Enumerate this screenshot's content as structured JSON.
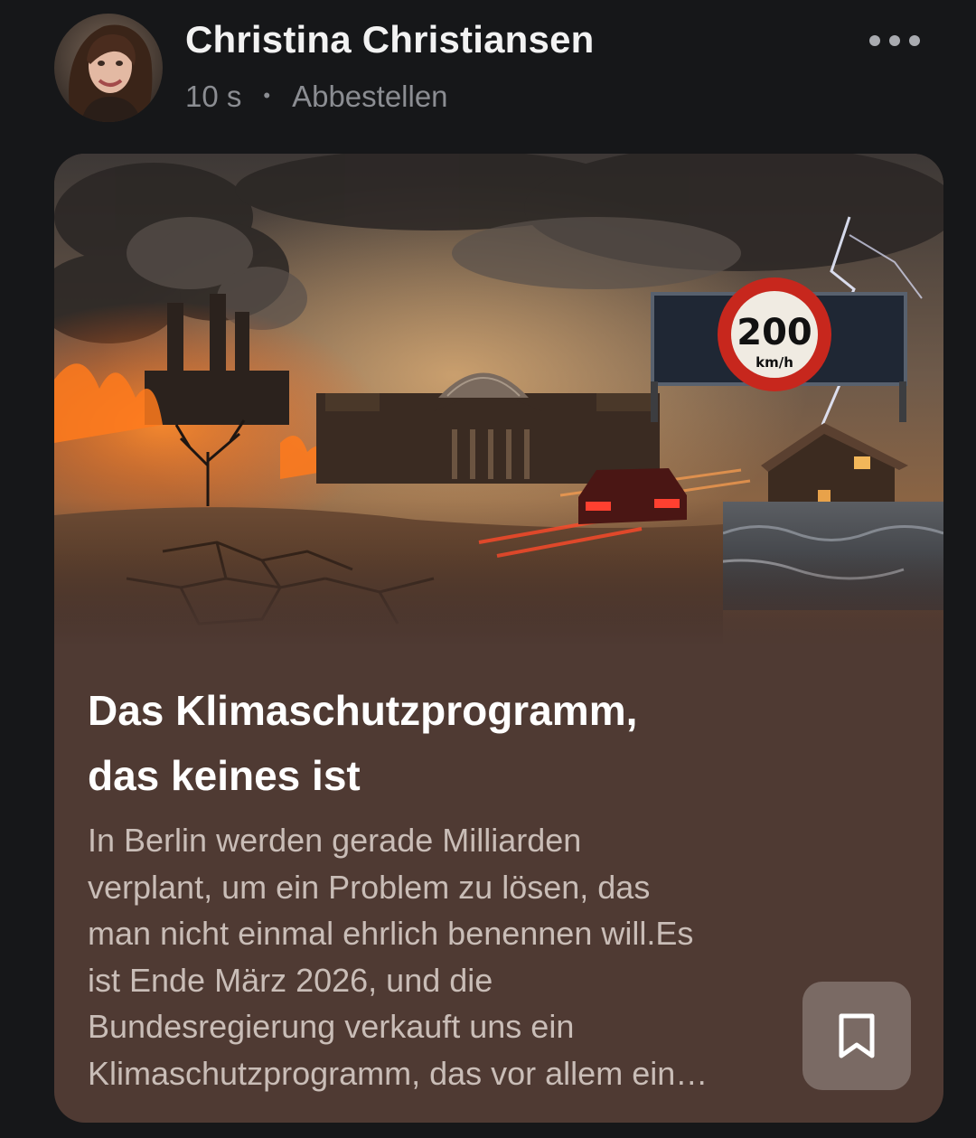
{
  "post": {
    "author_name": "Christina Christiansen",
    "time_ago": "10 s",
    "separator": "•",
    "unsubscribe_label": "Abbestellen"
  },
  "icons": {
    "more": "more-horizontal-icon",
    "bookmark": "bookmark-icon"
  },
  "card": {
    "title_line1": "Das Klimaschutzprogramm,",
    "title_line2": "das keines ist",
    "excerpt_lines": [
      "In Berlin werden gerade Milliarden",
      "verplant, um ein Problem zu lösen, das",
      "man nicht einmal ehrlich benennen will.Es",
      "ist Ende März 2026, und die",
      "Bundesregierung verkauft uns ein",
      "Klimaschutzprogramm, das vor allem ein…"
    ],
    "image": {
      "sign_value": "200",
      "sign_unit": "km/h"
    }
  },
  "colors": {
    "background": "#161719",
    "card_background": "#4f3a33",
    "bookmark_button": "#7a6a64",
    "muted_text": "#8b8d92"
  }
}
